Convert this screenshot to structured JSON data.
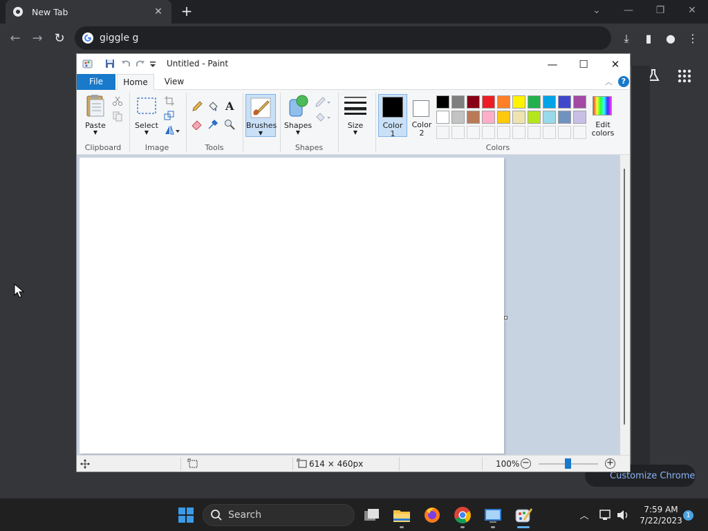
{
  "chrome": {
    "tab_title": "New Tab",
    "omnibox_text": "giggle g",
    "customize_label": "Customize Chrome"
  },
  "paint": {
    "window_title": "Untitled - Paint",
    "tabs": {
      "file": "File",
      "home": "Home",
      "view": "View"
    },
    "ribbon": {
      "paste": "Paste",
      "select": "Select",
      "brushes": "Brushes",
      "shapes": "Shapes",
      "size": "Size",
      "color1_line1": "Color",
      "color1_line2": "1",
      "color2_line1": "Color",
      "color2_line2": "2",
      "edit_colors_line1": "Edit",
      "edit_colors_line2": "colors",
      "groups": {
        "clipboard": "Clipboard",
        "image": "Image",
        "tools": "Tools",
        "shapes": "Shapes",
        "colors": "Colors"
      }
    },
    "palette": {
      "row1": [
        "#000000",
        "#7f7f7f",
        "#880015",
        "#ed1c24",
        "#ff7f27",
        "#fff200",
        "#22b14c",
        "#00a2e8",
        "#3f48cc",
        "#a349a4"
      ],
      "row2": [
        "#ffffff",
        "#c3c3c3",
        "#b97a57",
        "#ffaec9",
        "#ffc90e",
        "#efe4b0",
        "#b5e61d",
        "#99d9ea",
        "#7092be",
        "#c8bfe7"
      ]
    },
    "color1": "#000000",
    "color2": "#ffffff",
    "status": {
      "image_size": "614 × 460px",
      "zoom": "100%"
    }
  },
  "taskbar": {
    "search_label": "Search",
    "time": "7:59 AM",
    "date": "7/22/2023",
    "notification_count": "1"
  }
}
